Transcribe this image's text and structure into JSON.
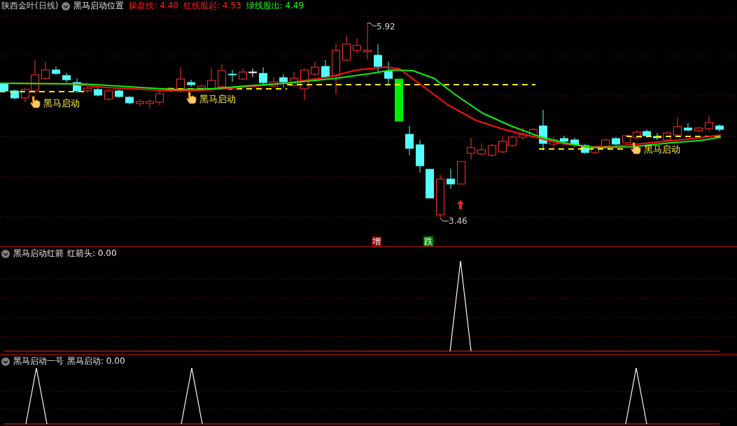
{
  "main_pane": {
    "stock_name": "陕西金叶(日线)",
    "indicator": "黑马启动位置",
    "readings": [
      {
        "text": "操盘线: 4.40",
        "color": "#ff2020"
      },
      {
        "text": "红线股起: 4.53",
        "color": "#ff2020"
      },
      {
        "text": "绿线股出: 4.49",
        "color": "#20ff20"
      }
    ],
    "high_label": "5.92",
    "low_label": "3.46",
    "signal_labels": [
      "黑马启动",
      "黑马启动",
      "黑马启动"
    ],
    "markers": [
      {
        "text": "增",
        "color": "#8b0000"
      },
      {
        "text": "跌",
        "color": "#008000"
      }
    ]
  },
  "panes": [
    {
      "name": "黑马启动红箭",
      "reading": "红箭头: 0.00"
    },
    {
      "name": "黑马启动一号",
      "reading": "黑马启动: 0.00"
    }
  ]
}
